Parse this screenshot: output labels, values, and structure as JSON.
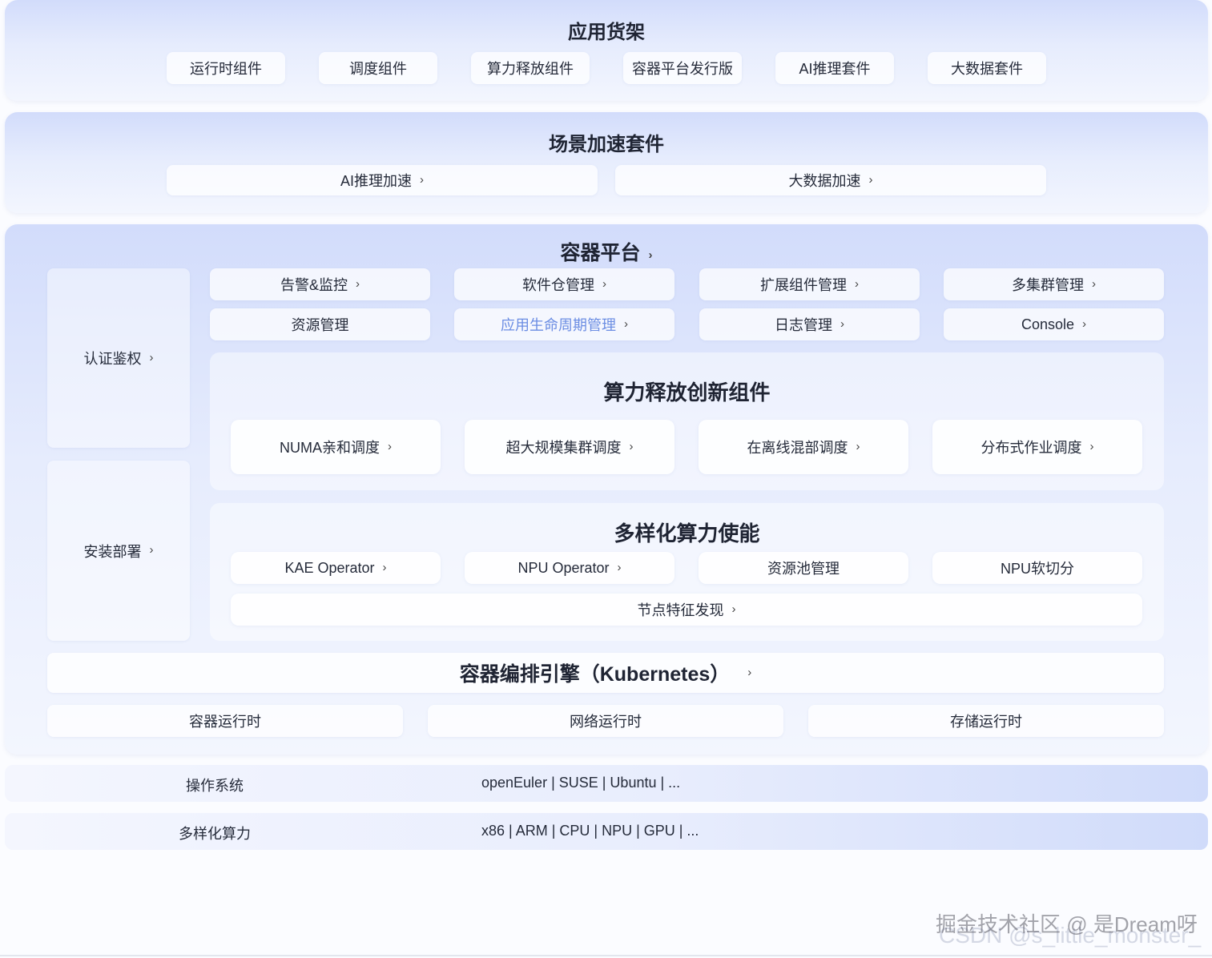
{
  "shelf": {
    "title": "应用货架",
    "items": [
      "运行时组件",
      "调度组件",
      "算力释放组件",
      "容器平台发行版",
      "AI推理套件",
      "大数据套件"
    ]
  },
  "accel": {
    "title": "场景加速套件",
    "items": [
      "AI推理加速",
      "大数据加速"
    ]
  },
  "platform": {
    "title": "容器平台",
    "side": [
      "认证鉴权",
      "安装部署"
    ],
    "mgmt_row1": [
      "告警&监控",
      "软件仓管理",
      "扩展组件管理",
      "多集群管理"
    ],
    "mgmt_row2": [
      "资源管理",
      "应用生命周期管理",
      "日志管理",
      "Console"
    ],
    "innovation": {
      "title": "算力释放创新组件",
      "items": [
        "NUMA亲和调度",
        "超大规模集群调度",
        "在离线混部调度",
        "分布式作业调度"
      ]
    },
    "diverse": {
      "title": "多样化算力使能",
      "items": [
        "KAE Operator",
        "NPU Operator",
        "资源池管理",
        "NPU软切分"
      ],
      "wide": "节点特征发现"
    },
    "k8s": "容器编排引擎（Kubernetes）",
    "runtimes": [
      "容器运行时",
      "网络运行时",
      "存储运行时"
    ]
  },
  "os": {
    "label": "操作系统",
    "value": "openEuler | SUSE | Ubuntu | ..."
  },
  "compute": {
    "label": "多样化算力",
    "value": "x86 | ARM | CPU | NPU | GPU | ..."
  },
  "watermark": {
    "line1": "掘金技术社区 @ 是Dream呀",
    "line2": "CSDN @s_little_monster_"
  },
  "colors": {
    "link": "#6b8de3",
    "band_top": "#d2dcfb",
    "text": "#252b3a"
  },
  "icons": {
    "chevron": "chevron-right-icon"
  }
}
